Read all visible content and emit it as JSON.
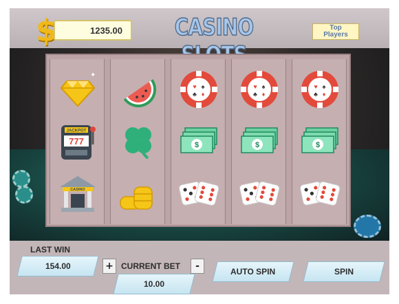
{
  "header": {
    "balance": "1235.00",
    "title": "CASINO SLOTS",
    "top_players_label": "Top\nPlayers"
  },
  "reels": [
    [
      "diamond-icon",
      "slot-machine-icon",
      "casino-building-icon"
    ],
    [
      "watermelon-icon",
      "clover-icon",
      "coin-stack-icon"
    ],
    [
      "poker-chip-icon",
      "cash-stack-icon",
      "dice-icon"
    ],
    [
      "poker-chip-icon",
      "cash-stack-icon",
      "dice-icon"
    ],
    [
      "poker-chip-icon",
      "cash-stack-icon",
      "dice-icon"
    ]
  ],
  "symbol_text": {
    "jackpot": "JACKPOT",
    "sevens": "777",
    "casino": "CASINO"
  },
  "controls": {
    "last_win_label": "LAST WIN",
    "last_win_value": "154.00",
    "plus_label": "+",
    "current_bet_label": "CURRENT BET",
    "minus_label": "-",
    "current_bet_value": "10.00",
    "auto_spin_label": "AUTO SPIN",
    "spin_label": "SPIN"
  },
  "colors": {
    "title": "#a7c6e8",
    "button": "#cfe9f4",
    "panel": "#c3b6b8",
    "dollar": "#f0b91a"
  }
}
